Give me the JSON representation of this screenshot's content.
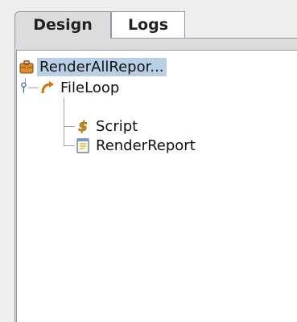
{
  "tabs": {
    "design_label": "Design",
    "logs_label": "Logs"
  },
  "tree": {
    "root": {
      "label": "RenderAllRepor...",
      "icon": "briefcase-icon"
    },
    "loop": {
      "label": "FileLoop",
      "icon": "loop-arrow-icon",
      "toggle": "expanded-toggle-icon"
    },
    "children": [
      {
        "label": "Script",
        "icon": "dollar-script-icon"
      },
      {
        "label": "RenderReport",
        "icon": "report-document-icon"
      }
    ]
  },
  "colors": {
    "selection": "#b8cfe5",
    "panel_bg": "#ffffff",
    "tab_active_bg": "#dcdcdc",
    "window_bg": "#eeeeee",
    "border": "#8f9aa6"
  }
}
